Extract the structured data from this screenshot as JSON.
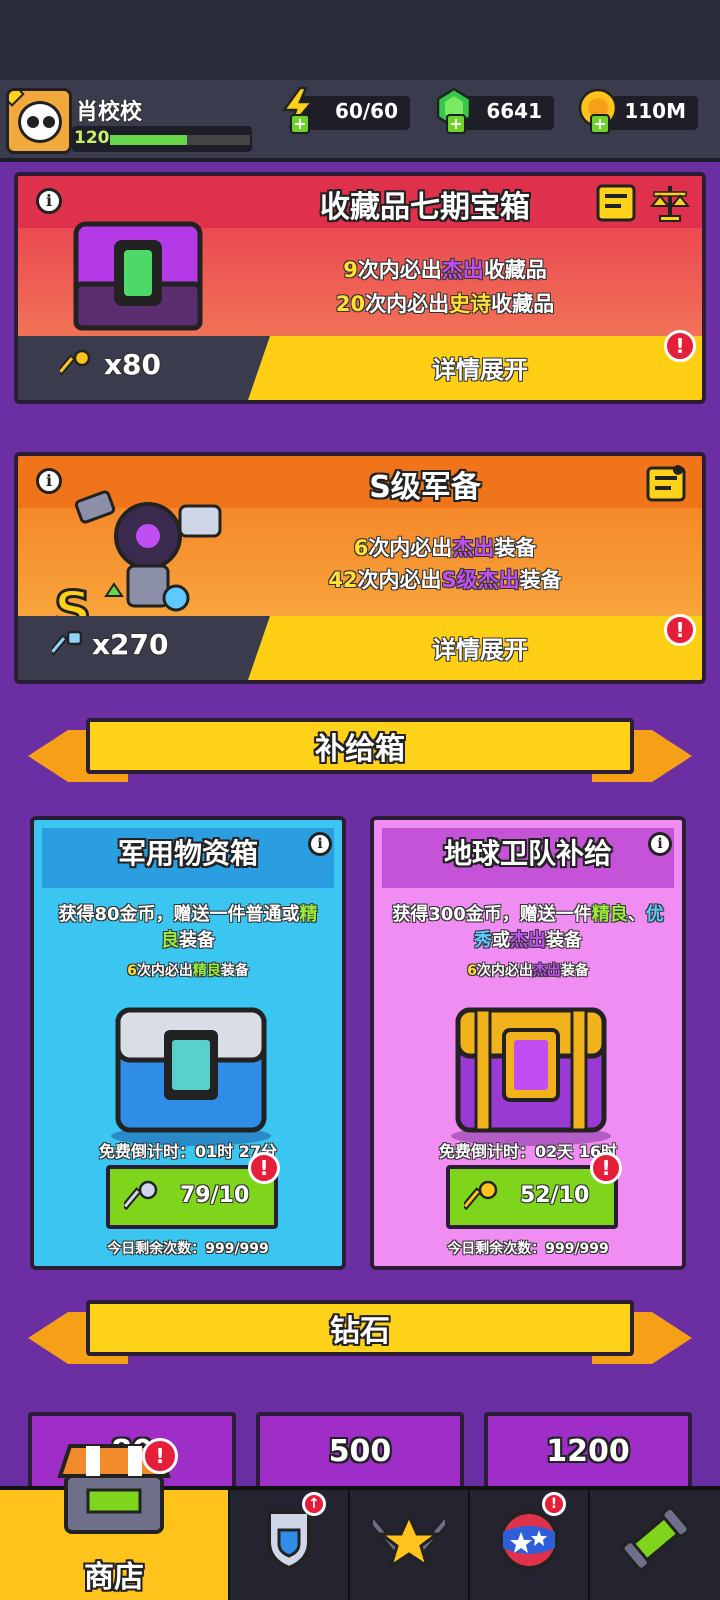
{
  "player": {
    "name": "肖校校",
    "level": "120",
    "xp_fraction": 0.55
  },
  "resources": {
    "energy": {
      "icon": "lightning-icon",
      "value": "60/60"
    },
    "gems": {
      "icon": "gem-icon",
      "value": "6641"
    },
    "coins": {
      "icon": "coin-icon",
      "value": "110M"
    }
  },
  "collection_chest": {
    "title": "收藏品七期宝箱",
    "line1": {
      "count": "9",
      "mid": "次内必出",
      "tier": "杰出",
      "tail": "收藏品"
    },
    "line2": {
      "count": "20",
      "mid": "次内必出",
      "tier": "史诗",
      "tail": "收藏品"
    },
    "keys": "x80",
    "details_button": "详情展开"
  },
  "s_gear": {
    "title": "S级军备",
    "line1": {
      "count": "6",
      "mid": "次内必出",
      "tier": "杰出",
      "tail": "装备"
    },
    "line2": {
      "count": "42",
      "mid": "次内必出",
      "tier": "S级杰出",
      "tail": "装备"
    },
    "keys": "x270",
    "details_button": "详情展开"
  },
  "supply_section": {
    "title": "补给箱"
  },
  "military_supply": {
    "title": "军用物资箱",
    "desc_part1": "获得80金币，赠送一件普通或",
    "desc_hl": "精良",
    "desc_part2": "装备",
    "pity_count": "6",
    "pity_mid": "次内必出",
    "pity_tier": "精良",
    "pity_tail": "装备",
    "timer": "免费倒计时：01时 27分",
    "button_value": "79/10",
    "remaining": "今日剩余次数：999/999"
  },
  "earth_supply": {
    "title": "地球卫队补给",
    "desc_part1": "获得300金币，赠送一件",
    "desc_hl1": "精良",
    "desc_sep": "、",
    "desc_hl2": "优秀",
    "desc_or": "或",
    "desc_hl3": "杰出",
    "desc_tail": "装备",
    "pity_count": "6",
    "pity_mid": "次内必出",
    "pity_tier": "杰出",
    "pity_tail": "装备",
    "timer": "免费倒计时：02天 16时",
    "button_value": "52/10",
    "remaining": "今日剩余次数：999/999"
  },
  "diamond_section": {
    "title": "钻石"
  },
  "diamond_tiles": [
    "80",
    "500",
    "1200"
  ],
  "nav": {
    "shop_label": "商店",
    "tabs": [
      "shop-icon",
      "shield-badge-icon",
      "star-swords-icon",
      "planet-icon",
      "capsule-icon"
    ]
  },
  "alert_mark": "!",
  "info_mark": "i",
  "colors": {
    "background": "#6b2fa3",
    "accent_yellow": "#ffd21a",
    "alert_red": "#e51e3a",
    "button_green": "#7fd41c"
  }
}
